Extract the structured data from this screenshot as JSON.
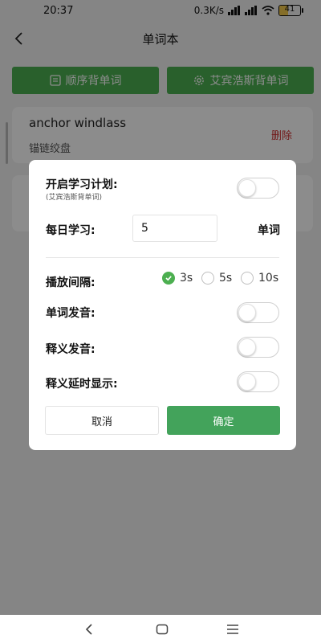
{
  "status": {
    "time": "20:37",
    "speed": "0.3K/s",
    "battery": "41",
    "battery_fraction": 0.41
  },
  "header": {
    "title": "单词本"
  },
  "actions": {
    "sequential": "顺序背单词",
    "ebbinghaus": "艾宾浩斯背单词"
  },
  "words": [
    {
      "word": "anchor windlass",
      "meaning": "锚链绞盘",
      "delete": "删除"
    }
  ],
  "modal": {
    "plan_label": "开启学习计划:",
    "plan_sub": "(艾宾浩斯背单词)",
    "daily_label": "每日学习:",
    "daily_value": "5",
    "daily_unit": "单词",
    "interval_label": "播放间隔:",
    "interval_options": [
      "3s",
      "5s",
      "10s"
    ],
    "interval_selected": "3s",
    "word_audio_label": "单词发音:",
    "meaning_audio_label": "释义发音:",
    "delay_label": "释义延时显示:",
    "toggles": {
      "plan": false,
      "word_audio": false,
      "meaning_audio": false,
      "delay": false
    },
    "cancel": "取消",
    "confirm": "确定"
  },
  "colors": {
    "accent": "#4caf50",
    "confirm": "#43a35b",
    "delete": "#d03030"
  }
}
